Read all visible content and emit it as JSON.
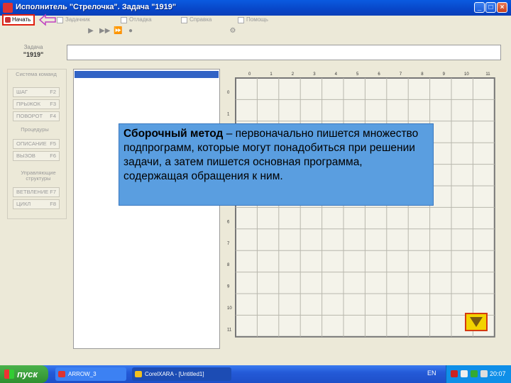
{
  "window": {
    "title": "Исполнитель \"Стрелочка\".  Задача  \"1919\""
  },
  "menu": {
    "start_label": "Начать",
    "items": [
      "Задачник",
      "Отладка",
      "Справка",
      "Помощь"
    ]
  },
  "task": {
    "label": "Задача",
    "number": "\"1919\""
  },
  "commands": {
    "heading_system": "Система команд",
    "heading_procedures": "Процедуры",
    "heading_control": "Управляющие структуры",
    "buttons": [
      {
        "label": "ШАГ",
        "key": "F2"
      },
      {
        "label": "ПРЫЖОК",
        "key": "F3"
      },
      {
        "label": "ПОВОРОТ",
        "key": "F4"
      },
      {
        "label": "ОПИСАНИЕ",
        "key": "F5"
      },
      {
        "label": "ВЫЗОВ",
        "key": "F6"
      },
      {
        "label": "ВЕТВЛЕНИЕ",
        "key": "F7"
      },
      {
        "label": "ЦИКЛ",
        "key": "F8"
      }
    ]
  },
  "grid": {
    "columns": [
      "0",
      "1",
      "2",
      "3",
      "4",
      "5",
      "6",
      "7",
      "8",
      "9",
      "10",
      "11"
    ],
    "rows": [
      "0",
      "1",
      "2",
      "3",
      "4",
      "5",
      "6",
      "7",
      "8",
      "9",
      "10",
      "11"
    ]
  },
  "info": {
    "term": "Сборочный метод",
    "text": " – первоначально пишется множество подпрограмм, которые могут понадобиться при решении задачи, а затем пишется основная программа, содержащая обращения к ним."
  },
  "taskbar": {
    "start": "пуск",
    "tasks": [
      "ARROW_3",
      "CorelXARA - [Untitled1]"
    ],
    "lang": "EN",
    "clock": "20:07"
  },
  "colors": {
    "info_bg": "#5a9ee0",
    "selection": "#3163c5",
    "start_highlight": "#e02010"
  }
}
